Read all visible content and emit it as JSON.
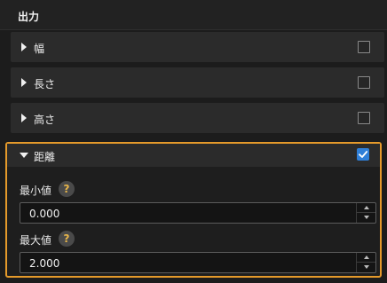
{
  "panel": {
    "title": "出力"
  },
  "rows": [
    {
      "label": "幅",
      "checked": false
    },
    {
      "label": "長さ",
      "checked": false
    },
    {
      "label": "高さ",
      "checked": false
    }
  ],
  "distance": {
    "label": "距離",
    "checked": true,
    "min_label": "最小値",
    "min_value": "0.000",
    "max_label": "最大値",
    "max_value": "2.000",
    "help_symbol": "?"
  },
  "colors": {
    "highlight": "#e59a2b",
    "checkbox_checked": "#2f7fd8",
    "help_mark": "#e7b54a"
  },
  "icons": [
    "caret-right-icon",
    "caret-down-icon",
    "checkbox-icon",
    "checkmark-icon",
    "help-icon",
    "spin-up-icon",
    "spin-down-icon"
  ]
}
